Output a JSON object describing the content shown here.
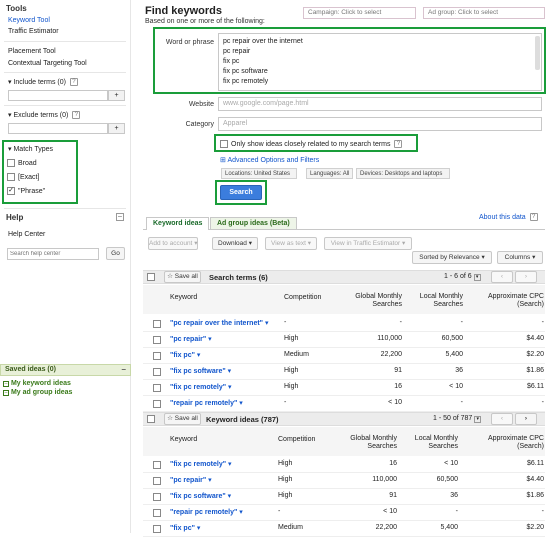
{
  "sidebar": {
    "tools_title": "Tools",
    "keyword_tool": "Keyword Tool",
    "traffic_estimator": "Traffic Estimator",
    "placement_tool": "Placement Tool",
    "contextual_tool": "Contextual Targeting Tool",
    "include_terms": "Include terms (0)",
    "exclude_terms": "Exclude terms (0)",
    "add_btn": "+",
    "match_types_title": "Match Types",
    "match_types": [
      {
        "label": "Broad",
        "checked": false
      },
      {
        "label": "[Exact]",
        "checked": false
      },
      {
        "label": "\"Phrase\"",
        "checked": true
      }
    ],
    "help_title": "Help",
    "help_center": "Help Center",
    "search_placeholder": "Search help center",
    "go_btn": "Go",
    "saved_ideas": "Saved ideas (0)",
    "my_keyword_ideas": "My keyword ideas",
    "my_ad_group_ideas": "My ad group ideas"
  },
  "main": {
    "title": "Find keywords",
    "subtitle": "Based on one or more of the following:",
    "campaign": "Campaign: Click to select",
    "ad_group": "Ad group: Click to select",
    "word_or_phrase_label": "Word or phrase",
    "phrases": [
      "pc repair over the internet",
      "pc repair",
      "fix pc",
      "fix pc software",
      "fix pc remotely"
    ],
    "website_label": "Website",
    "website_placeholder": "www.google.com/page.html",
    "category_label": "Category",
    "category_placeholder": "Apparel",
    "closely_related": "Only show ideas closely related to my search terms",
    "advanced": "Advanced Options and Filters",
    "locations": "Locations: United States",
    "languages": "Languages: All",
    "devices": "Devices: Desktops and laptops",
    "search_btn": "Search"
  },
  "tabs": {
    "keyword_ideas": "Keyword ideas",
    "ad_group_ideas": "Ad group ideas (Beta)",
    "about": "About this data"
  },
  "toolbar": {
    "add_to_account": "Add to account",
    "download": "Download",
    "view_as_text": "View as text",
    "view_in_te": "View in Traffic Estimator",
    "sorted_by": "Sorted by Relevance",
    "columns": "Columns"
  },
  "columns": {
    "keyword": "Keyword",
    "competition": "Competition",
    "global_1": "Global Monthly",
    "global_2": "Searches",
    "local_1": "Local Monthly",
    "local_2": "Searches",
    "cpc_1": "Approximate CPC",
    "cpc_2": "(Search)"
  },
  "search_terms": {
    "save_all": "Save all",
    "title": "Search terms (6)",
    "pager": "1 - 6 of 6",
    "rows": [
      {
        "kw": "\"pc repair over the internet\"",
        "comp": "-",
        "global": "-",
        "local": "-",
        "cpc": "-"
      },
      {
        "kw": "\"pc repair\"",
        "comp": "High",
        "global": "110,000",
        "local": "60,500",
        "cpc": "$4.40"
      },
      {
        "kw": "\"fix pc\"",
        "comp": "Medium",
        "global": "22,200",
        "local": "5,400",
        "cpc": "$2.20"
      },
      {
        "kw": "\"fix pc software\"",
        "comp": "High",
        "global": "91",
        "local": "36",
        "cpc": "$1.86"
      },
      {
        "kw": "\"fix pc remotely\"",
        "comp": "High",
        "global": "16",
        "local": "< 10",
        "cpc": "$6.11"
      },
      {
        "kw": "\"repair pc remotely\"",
        "comp": "-",
        "global": "< 10",
        "local": "-",
        "cpc": "-"
      }
    ]
  },
  "keyword_ideas": {
    "save_all": "Save all",
    "title": "Keyword ideas (787)",
    "pager": "1 - 50 of 787",
    "rows": [
      {
        "kw": "\"fix pc remotely\"",
        "comp": "High",
        "global": "16",
        "local": "< 10",
        "cpc": "$6.11"
      },
      {
        "kw": "\"pc repair\"",
        "comp": "High",
        "global": "110,000",
        "local": "60,500",
        "cpc": "$4.40"
      },
      {
        "kw": "\"fix pc software\"",
        "comp": "High",
        "global": "91",
        "local": "36",
        "cpc": "$1.86"
      },
      {
        "kw": "\"repair pc remotely\"",
        "comp": "-",
        "global": "< 10",
        "local": "-",
        "cpc": "-"
      },
      {
        "kw": "\"fix pc\"",
        "comp": "Medium",
        "global": "22,200",
        "local": "5,400",
        "cpc": "$2.20"
      }
    ]
  },
  "colors": {
    "highlight_box": "#1a9d3a",
    "link": "#1155cc",
    "search_button": "#3b7ddd"
  }
}
